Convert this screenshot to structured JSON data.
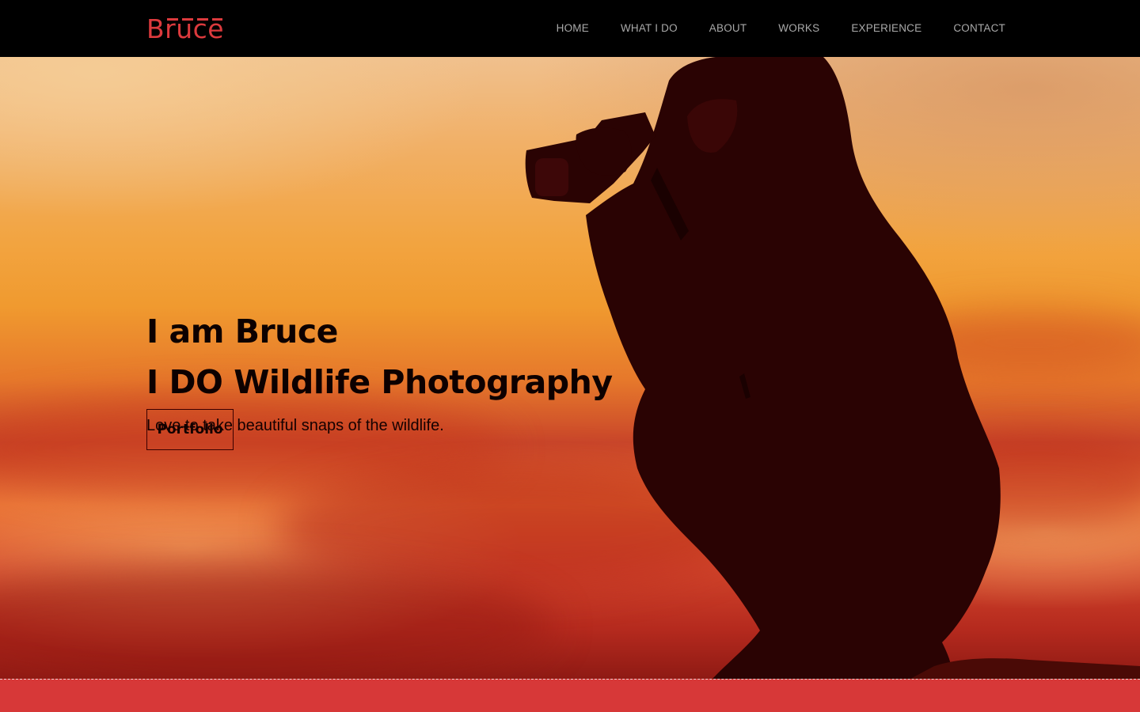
{
  "brand": {
    "name": "Bruce",
    "color": "#dc3a3d"
  },
  "nav": {
    "items": [
      {
        "label": "HOME"
      },
      {
        "label": "WHAT I DO"
      },
      {
        "label": "ABOUT"
      },
      {
        "label": "WORKS"
      },
      {
        "label": "EXPERIENCE"
      },
      {
        "label": "CONTACT"
      }
    ]
  },
  "hero": {
    "heading_line1": "I am Bruce",
    "heading_line2": "I DO Wildlife Photography",
    "subtitle": "Love to take beautiful snaps of the wildlife.",
    "button_label": "Portfolio"
  },
  "colors": {
    "nav_bg": "#000000",
    "nav_text": "#a9a9a9",
    "footer_bar": "#d73838"
  }
}
